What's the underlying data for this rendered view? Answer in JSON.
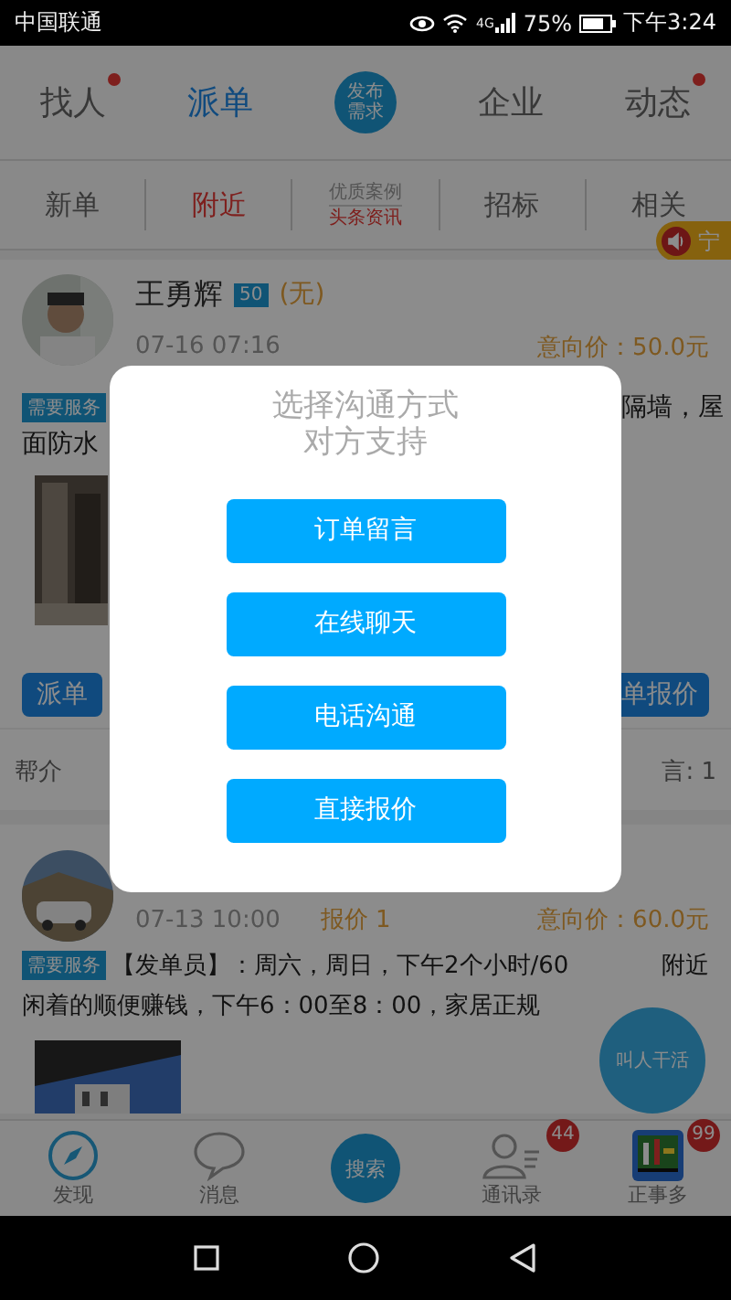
{
  "status_bar": {
    "carrier": "中国联通",
    "network": "4G",
    "battery": "75%",
    "time": "下午3:24"
  },
  "top_tabs": [
    {
      "label": "找人",
      "selected": false,
      "dot": true
    },
    {
      "label": "派单",
      "selected": true,
      "dot": false
    },
    {
      "kind": "publish",
      "lines": [
        "发布",
        "需求"
      ]
    },
    {
      "label": "企业",
      "selected": false,
      "dot": false
    },
    {
      "label": "动态",
      "selected": false,
      "dot": true
    }
  ],
  "sub_tabs": [
    {
      "kind": "text",
      "label": "新单",
      "selected": false
    },
    {
      "kind": "text",
      "label": "附近",
      "selected": true
    },
    {
      "kind": "stacked",
      "top": "优质案例",
      "bottom": "头条资讯"
    },
    {
      "kind": "text",
      "label": "招标",
      "selected": false
    },
    {
      "kind": "text",
      "label": "相关",
      "selected": false
    }
  ],
  "location_pill": "宁",
  "card_1": {
    "name": "王勇辉",
    "level": "50",
    "note": "(无)",
    "date": "07-16 07:16",
    "price": "意向价：50.0元",
    "tag": "需要服务",
    "text_right": "隔墙，屋",
    "text_left": "面防水",
    "action_left": "派单",
    "action_right": "单报价",
    "footer_left": "帮介",
    "footer_right": "言: 1"
  },
  "card_2": {
    "date": "07-13 10:00",
    "quotes": "报价 1",
    "price": "意向价：60.0元",
    "tag": "需要服务",
    "line_1": "【发单员】：周六，周日，下午2个小时/60",
    "line_1_end": "附近",
    "line_2": "闲着的顺便赚钱，下午6：00至8：00，家居正规"
  },
  "fab": "叫人干活",
  "bottom_nav": [
    {
      "kind": "compass",
      "label": "发现"
    },
    {
      "kind": "bubble",
      "label": "消息"
    },
    {
      "kind": "search",
      "label": "搜索"
    },
    {
      "kind": "contacts",
      "label": "通讯录",
      "badge": "44"
    },
    {
      "kind": "app",
      "label": "正事多",
      "badge": "99"
    }
  ],
  "dialog": {
    "title_lines": [
      "选择沟通方式",
      "对方支持"
    ],
    "buttons": [
      "订单留言",
      "在线聊天",
      "电话沟通",
      "直接报价"
    ]
  }
}
